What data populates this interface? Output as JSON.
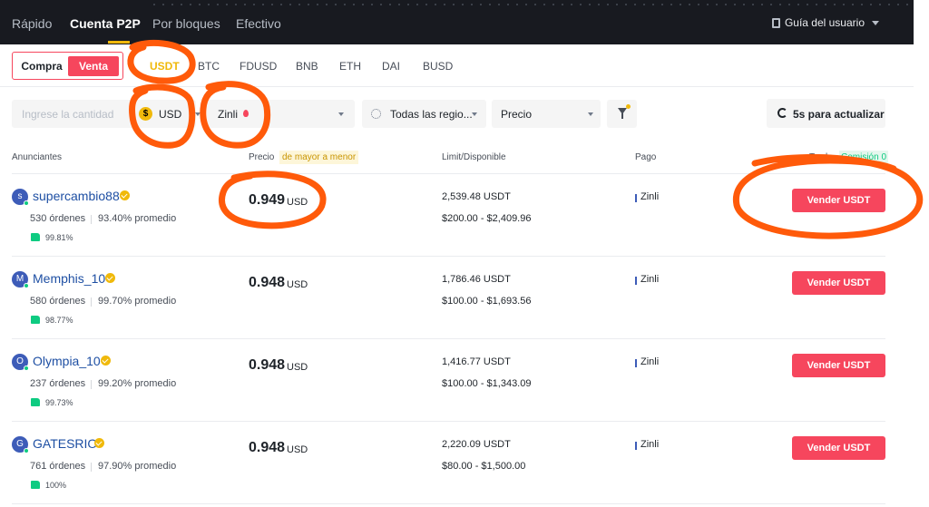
{
  "nav": {
    "tabs": [
      {
        "label": "Rápido"
      },
      {
        "label": "Cuenta P2P"
      },
      {
        "label": "Por bloques"
      },
      {
        "label": "Efectivo"
      }
    ],
    "user_guide": "Guía del usuario"
  },
  "trade_switch": {
    "buy": "Compra",
    "sell": "Venta",
    "active": "Venta"
  },
  "assets": [
    "USDT",
    "BTC",
    "FDUSD",
    "BNB",
    "ETH",
    "DAI",
    "BUSD"
  ],
  "active_asset": "USDT",
  "filters": {
    "amount_placeholder": "Ingrese la cantidad",
    "currency": "USD",
    "payment": "Zinli",
    "region": "Todas las regio...",
    "sort": "Precio",
    "refresh": "5s para actualizar"
  },
  "table": {
    "headers": {
      "advertisers": "Anunciantes",
      "price": "Precio",
      "price_sort": "de mayor a menor",
      "limit": "Limit/Disponible",
      "payment": "Pago",
      "trade": "Trade",
      "fee": "Comisión 0"
    },
    "rows": [
      {
        "initial": "s",
        "name": "supercambio88",
        "orders": "530 órdenes",
        "completion": "93.40% promedio",
        "rating": "99.81%",
        "price": "0.949",
        "unit": "USD",
        "available": "2,539.48 USDT",
        "limit": "$200.00 - $2,409.96",
        "payment": "Zinli",
        "action": "Vender USDT"
      },
      {
        "initial": "M",
        "name": "Memphis_10",
        "orders": "580 órdenes",
        "completion": "99.70% promedio",
        "rating": "98.77%",
        "price": "0.948",
        "unit": "USD",
        "available": "1,786.46 USDT",
        "limit": "$100.00 - $1,693.56",
        "payment": "Zinli",
        "action": "Vender USDT"
      },
      {
        "initial": "O",
        "name": "Olympia_10",
        "orders": "237 órdenes",
        "completion": "99.20% promedio",
        "rating": "99.73%",
        "price": "0.948",
        "unit": "USD",
        "available": "1,416.77 USDT",
        "limit": "$100.00 - $1,343.09",
        "payment": "Zinli",
        "action": "Vender USDT"
      },
      {
        "initial": "G",
        "name": "GATESRIO",
        "orders": "761 órdenes",
        "completion": "97.90% promedio",
        "rating": "100%",
        "price": "0.948",
        "unit": "USD",
        "available": "2,220.09 USDT",
        "limit": "$80.00 - $1,500.00",
        "payment": "Zinli",
        "action": "Vender USDT"
      }
    ]
  },
  "colors": {
    "nav_bg": "#181a20",
    "accent": "#f0b90b",
    "sell": "#f6465d",
    "annotation": "#ff5a0a"
  }
}
